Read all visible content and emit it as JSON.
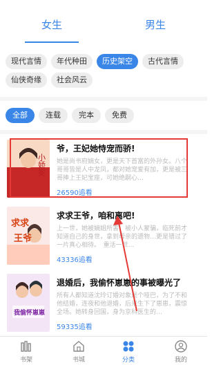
{
  "gender_tabs": [
    {
      "label": "女生",
      "active": true
    },
    {
      "label": "男生",
      "active": false
    }
  ],
  "genre_tags": [
    {
      "label": "现代言情",
      "active": false
    },
    {
      "label": "年代种田",
      "active": false
    },
    {
      "label": "历史架空",
      "active": true
    },
    {
      "label": "古代言情",
      "active": false
    },
    {
      "label": "仙侠奇缘",
      "active": false
    },
    {
      "label": "社会风云",
      "active": false
    }
  ],
  "filters": [
    {
      "label": "全部",
      "active": true
    },
    {
      "label": "连载",
      "active": false
    },
    {
      "label": "完本",
      "active": false
    },
    {
      "label": "免费",
      "active": false
    }
  ],
  "books": [
    {
      "title": "爷，王妃她恃宠而骄!",
      "description": "她是尚书府嫡女，更是天下首富的外孙女。八个哥哥皆是人中龙凤，都对她宠爱有加，更是被三哥捧上王妃宝座，可她绝嗣心…",
      "reads": "26590追看",
      "cover_text": "小娇冕",
      "cover_colors": [
        "#c62828",
        "#f7d9c4"
      ]
    },
    {
      "title": "求求王爷，咱和离吧!",
      "description": "上一世，她被嫡姐所害，被小人蒙骗，临死前才知道自己的身世，拿到母亲的遗物…更是错过了一片真心相待。　重活一世…",
      "reads": "43336追看",
      "cover_text": "求求王爷",
      "cover_colors": [
        "#d84315",
        "#fbe9e7"
      ]
    },
    {
      "title": "退婚后，我偷怀崽崽的事被曝光了",
      "description": "所有人都知道沈玲订婚对象是个哑巴，为了不和他结婚，连夜和他退婚，后来生下了崽崽，震惊全场。她转身回国，身为京科医生的…",
      "reads": "59335追看",
      "cover_text": "我偷怀崽崽",
      "cover_colors": [
        "#7b1fa2",
        "#f3e5f5"
      ]
    }
  ],
  "bottom_nav": [
    {
      "label": "书架",
      "icon": "bookshelf-icon",
      "active": false
    },
    {
      "label": "书城",
      "icon": "bookstore-icon",
      "active": false
    },
    {
      "label": "分类",
      "icon": "category-icon",
      "active": true
    },
    {
      "label": "我的",
      "icon": "profile-icon",
      "active": false
    }
  ],
  "colors": {
    "accent": "#3a86e8",
    "highlight": "#e53935"
  }
}
